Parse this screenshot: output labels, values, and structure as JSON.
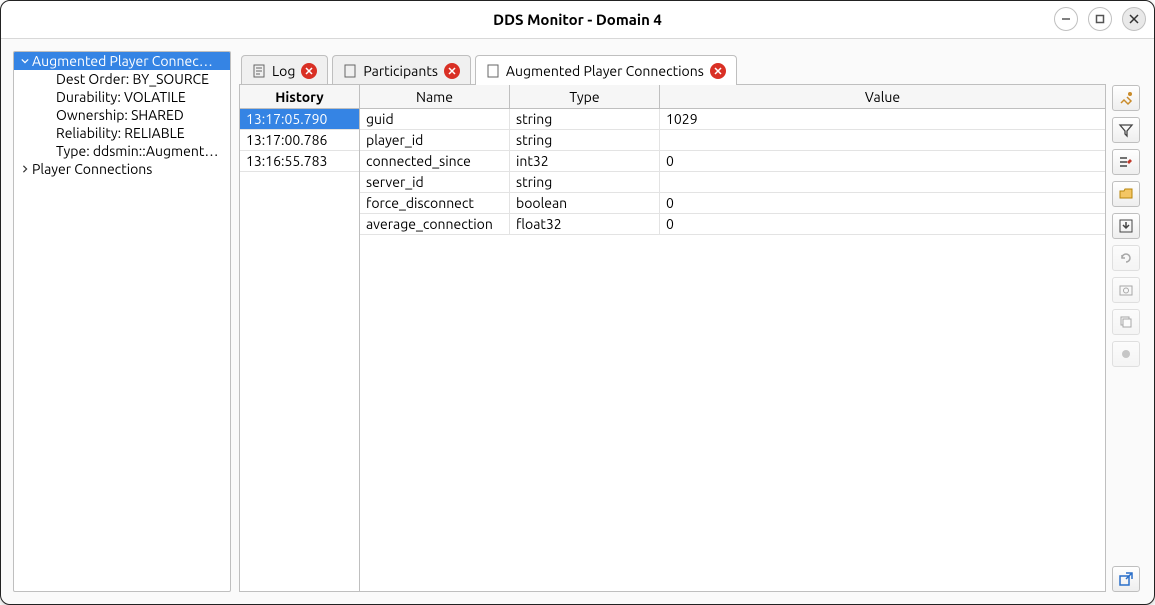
{
  "window": {
    "title": "DDS Monitor - Domain 4"
  },
  "sidebar": {
    "items": [
      {
        "label": "Augmented Player Connec…",
        "expanded": true,
        "selected": true,
        "children": [
          {
            "label": "Dest Order: BY_SOURCE"
          },
          {
            "label": "Durability: VOLATILE"
          },
          {
            "label": "Ownership: SHARED"
          },
          {
            "label": "Reliability: RELIABLE"
          },
          {
            "label": "Type: ddsmin::Augment…"
          }
        ]
      },
      {
        "label": "Player Connections",
        "expanded": false,
        "selected": false
      }
    ]
  },
  "tabs": [
    {
      "label": "Log",
      "active": false
    },
    {
      "label": "Participants",
      "active": false
    },
    {
      "label": "Augmented Player Connections",
      "active": true
    }
  ],
  "history": {
    "header": "History",
    "rows": [
      {
        "ts": "13:17:05.790",
        "selected": true
      },
      {
        "ts": "13:17:00.786",
        "selected": false
      },
      {
        "ts": "13:16:55.783",
        "selected": false
      }
    ]
  },
  "detail": {
    "headers": {
      "name": "Name",
      "type": "Type",
      "value": "Value"
    },
    "rows": [
      {
        "name": "guid",
        "type": "string",
        "value": "1029"
      },
      {
        "name": "player_id",
        "type": "string",
        "value": ""
      },
      {
        "name": "connected_since",
        "type": "int32",
        "value": "0"
      },
      {
        "name": "server_id",
        "type": "string",
        "value": ""
      },
      {
        "name": "force_disconnect",
        "type": "boolean",
        "value": "0"
      },
      {
        "name": "average_connection",
        "type": "float32",
        "value": "0"
      }
    ]
  },
  "tools": [
    {
      "name": "brush-icon",
      "disabled": false
    },
    {
      "name": "filter-icon",
      "disabled": false
    },
    {
      "name": "list-edit-icon",
      "disabled": false
    },
    {
      "name": "folder-open-icon",
      "disabled": false
    },
    {
      "name": "export-icon",
      "disabled": false
    },
    {
      "name": "refresh-icon",
      "disabled": true
    },
    {
      "name": "snapshot-icon",
      "disabled": true
    },
    {
      "name": "copy-icon",
      "disabled": true
    },
    {
      "name": "record-icon",
      "disabled": true
    }
  ],
  "popout_tool": {
    "name": "popout-icon"
  }
}
